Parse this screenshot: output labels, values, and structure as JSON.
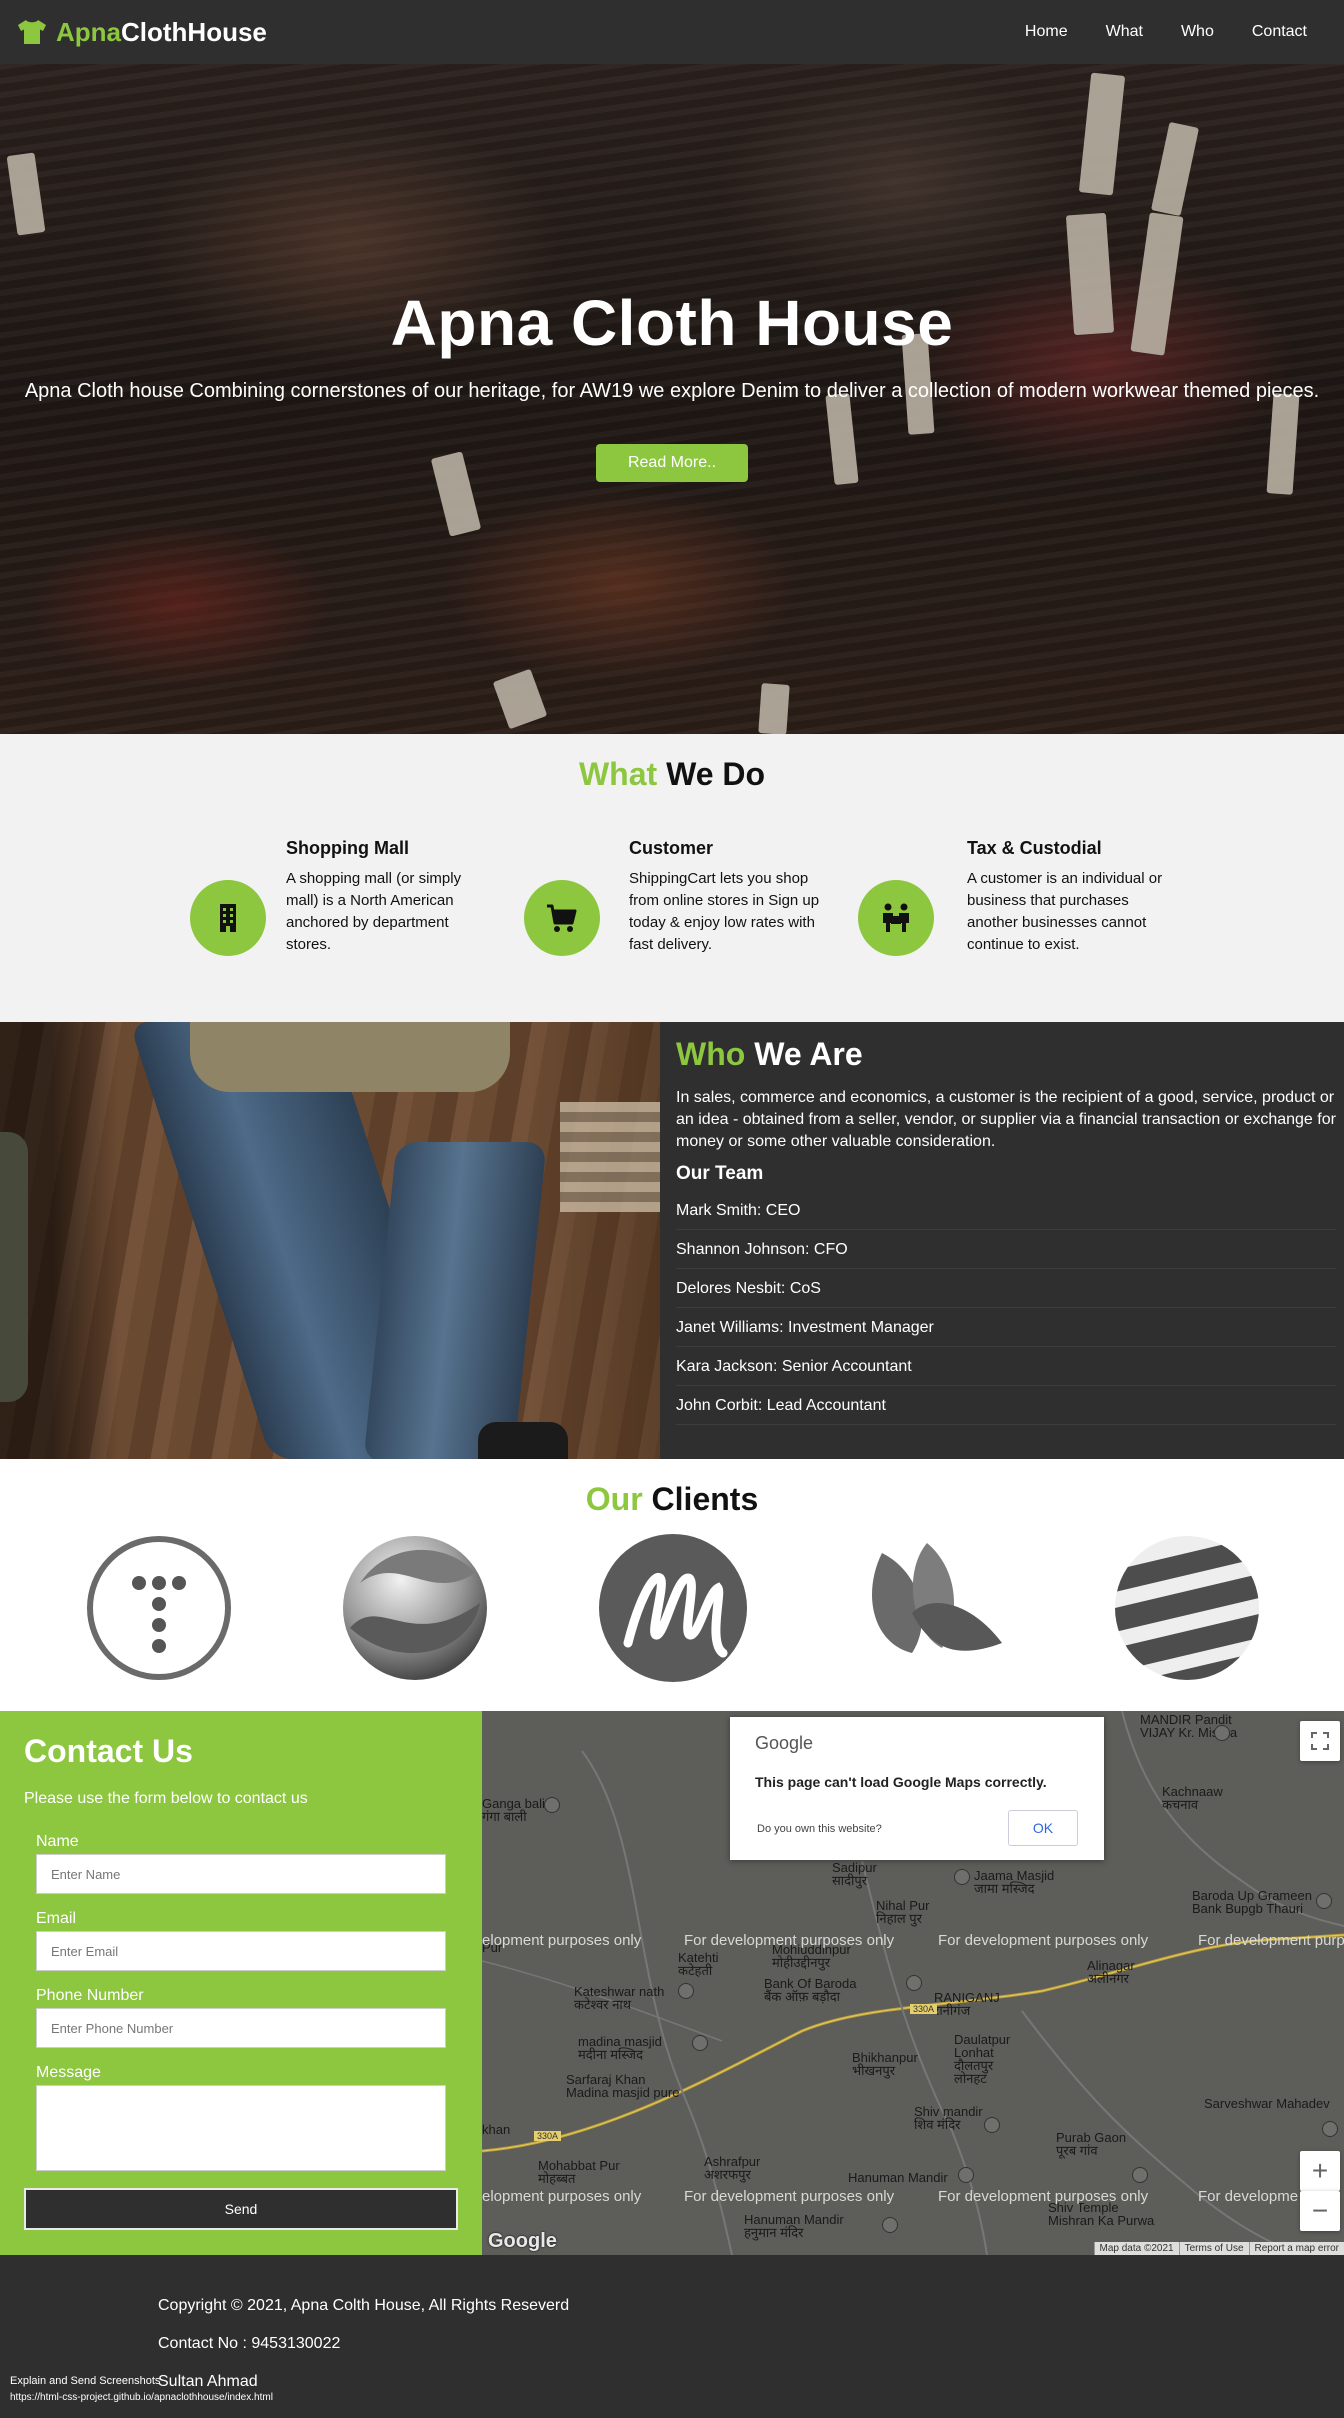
{
  "nav": {
    "brand_accent": "Apna",
    "brand_rest": "ClothHouse",
    "links": [
      "Home",
      "What",
      "Who",
      "Contact"
    ]
  },
  "hero": {
    "title": "Apna Cloth House",
    "subtitle": "Apna Cloth house Combining cornerstones of our heritage, for AW19 we explore Denim to deliver a collection of modern workwear themed pieces.",
    "button": "Read More.."
  },
  "what": {
    "title_accent": "What",
    "title_rest": " We Do",
    "services": [
      {
        "icon": "building-icon",
        "title": "Shopping Mall",
        "text": "A shopping mall (or simply mall) is a North American anchored by department stores."
      },
      {
        "icon": "cart-icon",
        "title": "Customer",
        "text": "ShippingCart lets you shop from online stores in Sign up today & enjoy low rates with fast delivery."
      },
      {
        "icon": "people-carry-icon",
        "title": "Tax & Custodial",
        "text": "A customer is an individual or business that purchases another businesses cannot continue to exist."
      }
    ]
  },
  "who": {
    "title_accent": "Who",
    "title_rest": " We Are",
    "lead": "In sales, commerce and economics, a customer is the recipient of a good, service, product or an idea - obtained from a seller, vendor, or supplier via a financial transaction or exchange for money or some other valuable consideration.",
    "team_heading": "Our Team",
    "team": [
      "Mark Smith: CEO",
      "Shannon Johnson: CFO",
      "Delores Nesbit: CoS",
      "Janet Williams: Investment Manager",
      "Kara Jackson: Senior Accountant",
      "John Corbit: Lead Accountant"
    ]
  },
  "clients": {
    "title_accent": "Our",
    "title_rest": " Clients",
    "logos": [
      "t-dots-logo",
      "swirl-sphere-logo",
      "m-script-logo",
      "leaves-logo",
      "striped-globe-logo"
    ]
  },
  "contact": {
    "title": "Contact Us",
    "subtitle": "Please use the form below to contact us",
    "fields": [
      {
        "label": "Name",
        "placeholder": "Enter Name"
      },
      {
        "label": "Email",
        "placeholder": "Enter Email"
      },
      {
        "label": "Phone Number",
        "placeholder": "Enter Phone Number"
      },
      {
        "label": "Message",
        "placeholder": ""
      }
    ],
    "send": "Send"
  },
  "map": {
    "dialog_logo": "Google",
    "dialog_message": "This page can't load Google Maps correctly.",
    "dialog_own": "Do you own this website?",
    "dialog_ok": "OK",
    "dev_text": "For development purposes only",
    "dev_text_left": "elopment purposes only",
    "dev_text_right": "For developme",
    "dev_text_right2": "For development purp",
    "places": [
      {
        "name": "MANDIR Pandit\nVIJAY Kr. Mishra"
      },
      {
        "name": "Kachnaaw\nकचनाव"
      },
      {
        "name": "Sadipur\nसादीपुर"
      },
      {
        "name": "Jaama Masjid\nजामा मस्जिद"
      },
      {
        "name": "Nihal Pur\nनिहाल पुर"
      },
      {
        "name": "Katehti\nकटेहती"
      },
      {
        "name": "Mohiuddinpur\nमोहीउद्दीनपुर"
      },
      {
        "name": "Bank Of Baroda\nबैंक ऑफ़ बड़ौदा"
      },
      {
        "name": "Kateshwar nath\nकटेश्वर नाथ"
      },
      {
        "name": "RANIGANJ\nरानीगंज"
      },
      {
        "name": "Alinagar\nअलीनगर"
      },
      {
        "name": "Baroda Up Grameen\nBank Bupgb Thauri"
      },
      {
        "name": "madina masjid\nमदीना मस्जिद"
      },
      {
        "name": "Daulatpur\nLonhat\nदौलतपुर\nलोनहट"
      },
      {
        "name": "Sarfaraj Khan\nMadina masjid pure"
      },
      {
        "name": "Bhikhanpur\nभीखनपुर"
      },
      {
        "name": "Shiv mandir\nशिव मंदिर"
      },
      {
        "name": "Sarveshwar Mahadev"
      },
      {
        "name": "Purab Gaon\nपूरब गांव"
      },
      {
        "name": "Mohabbat Pur\nमोहब्बत"
      },
      {
        "name": "Ashrafpur\nअशरफपुर"
      },
      {
        "name": "Hanuman Mandir"
      },
      {
        "name": "Shiv Temple\nMishran Ka Purwa"
      },
      {
        "name": "Hanuman Mandir\nहनुमान मंदिर"
      },
      {
        "name": "Ganga bali\nगंगा बाली"
      },
      {
        "name": "khan"
      },
      {
        "name": "Pur"
      }
    ],
    "road_badge_1": "330A",
    "road_badge_2": "330A",
    "attribution": [
      "Map data ©2021",
      "Terms of Use",
      "Report a map error"
    ],
    "google_mark": "Google"
  },
  "footer": {
    "copyright": "Copyright © 2021, Apna Colth House, All Rights Reseverd",
    "contact": "Contact No : 9453130022",
    "author": "Sultan Ahmad"
  },
  "overlay": {
    "note": "Explain and Send Screenshots",
    "url": "https://html-css-project.github.io/apnaclothhouse/index.html"
  },
  "colors": {
    "accent": "#8dc63f",
    "dark": "#2f2f2f",
    "light": "#f2f2f2"
  }
}
